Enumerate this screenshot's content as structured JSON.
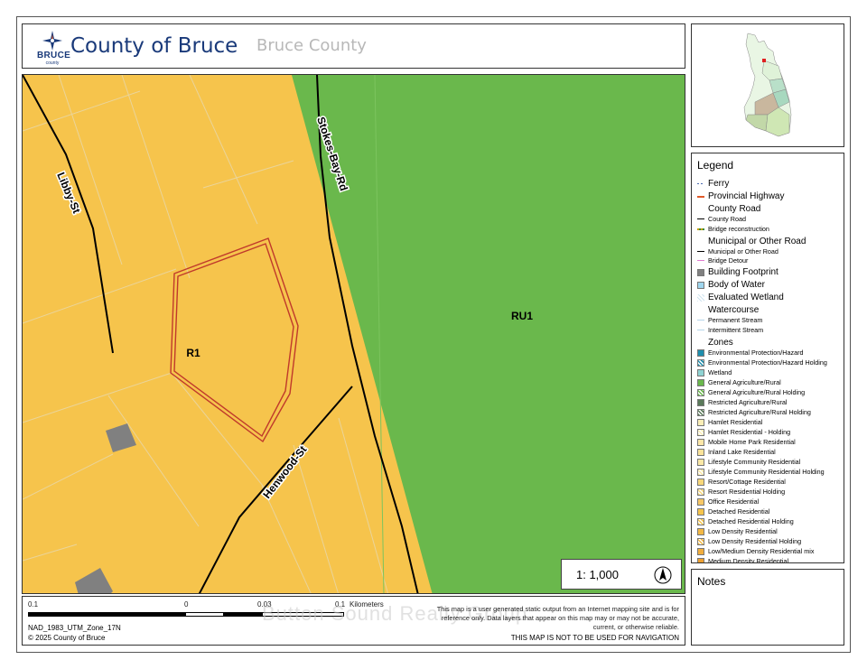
{
  "header": {
    "brand": "BRUCE",
    "brand_sub": "county",
    "title": "County of Bruce",
    "subtitle": "Bruce County"
  },
  "map": {
    "labels": {
      "zone_r1": "R1",
      "zone_ru1": "RU1",
      "road_stokes": "Stokes-Bay-Rd",
      "road_libby": "Libby-St",
      "road_henwood": "Henwood-St"
    },
    "scale_text": "1: 1,000",
    "colors": {
      "residential": "#f6c44c",
      "agriculture": "#6ab84c",
      "building": "#808080",
      "parcel_outline": "#c0392b",
      "lot_lines": "#ead49a"
    }
  },
  "footer": {
    "ticks": [
      "0.1",
      "0",
      "0.03",
      "0.1",
      "Kilometers"
    ],
    "projection": "NAD_1983_UTM_Zone_17N",
    "copyright": "© 2025 County of Bruce",
    "disclaimer": "This map is a user generated static output from an Internet mapping site and is for reference only. Data layers that appear on this map may or may not be accurate, current, or otherwise reliable.",
    "nav_warning": "THIS MAP IS NOT TO BE USED FOR NAVIGATION",
    "watermark": "Button Sound Realty Group"
  },
  "legend": {
    "title": "Legend",
    "items": [
      {
        "label": "Ferry",
        "icon": "ferry-line",
        "size": "md"
      },
      {
        "label": "Provincial Highway",
        "icon": "highway-line",
        "size": "md",
        "color": "#e05a2a"
      },
      {
        "label": "County Road",
        "icon": "none",
        "size": "md"
      },
      {
        "label": "County Road",
        "icon": "black-line",
        "size": "sm"
      },
      {
        "label": "Bridge reconstruction",
        "icon": "bridge-line",
        "size": "sm"
      },
      {
        "label": "Municipal or Other Road",
        "icon": "none",
        "size": "md"
      },
      {
        "label": "Municipal or Other Road",
        "icon": "black-line",
        "size": "sm"
      },
      {
        "label": "Bridge Detour",
        "icon": "pink-line",
        "size": "sm"
      },
      {
        "label": "Building Footprint",
        "icon": "fill",
        "size": "md",
        "color": "#808080"
      },
      {
        "label": "Body of Water",
        "icon": "fill",
        "size": "md",
        "color": "#9fd6ee"
      },
      {
        "label": "Evaluated Wetland",
        "icon": "hatch-light",
        "size": "md",
        "color": "#ffffff"
      },
      {
        "label": "Watercourse",
        "icon": "none",
        "size": "md"
      },
      {
        "label": "Permanent Stream",
        "icon": "thin-line",
        "size": "sm"
      },
      {
        "label": "Intermittent Stream",
        "icon": "thin-line",
        "size": "sm"
      },
      {
        "label": "Zones",
        "icon": "none",
        "size": "md"
      },
      {
        "label": "Environmental Protection/Hazard",
        "icon": "fill",
        "size": "sm",
        "color": "#1f8fae"
      },
      {
        "label": "Environmental Protection/Hazard Holding",
        "icon": "hatch",
        "size": "sm",
        "color": "#1f8fae"
      },
      {
        "label": "Wetland",
        "icon": "fill",
        "size": "sm",
        "color": "#8fd3d3"
      },
      {
        "label": "General Agriculture/Rural",
        "icon": "fill",
        "size": "sm",
        "color": "#6ab84c"
      },
      {
        "label": "General Agriculture/Rural Holding",
        "icon": "hatch",
        "size": "sm",
        "color": "#6ab84c"
      },
      {
        "label": "Restricted Agriculture/Rural",
        "icon": "fill",
        "size": "sm",
        "color": "#5a7a5a"
      },
      {
        "label": "Restricted Agriculture/Rural Holding",
        "icon": "hatch",
        "size": "sm",
        "color": "#5a7a5a"
      },
      {
        "label": "Hamlet Residential",
        "icon": "fill",
        "size": "sm",
        "color": "#fbeeb6"
      },
      {
        "label": "Hamlet Residential - Holding",
        "icon": "hatch",
        "size": "sm",
        "color": "#fbeeb6"
      },
      {
        "label": "Mobile Home Park Residential",
        "icon": "fill",
        "size": "sm",
        "color": "#fde7a8"
      },
      {
        "label": "Inland Lake Residential",
        "icon": "fill",
        "size": "sm",
        "color": "#fbe39a"
      },
      {
        "label": "Lifestyle Community Residential",
        "icon": "fill",
        "size": "sm",
        "color": "#fbe8a6"
      },
      {
        "label": "Lifestyle Community Residential Holding",
        "icon": "hatch",
        "size": "sm",
        "color": "#fbe8a6"
      },
      {
        "label": "Resort/Cottage Residential",
        "icon": "fill",
        "size": "sm",
        "color": "#f8d77a"
      },
      {
        "label": "Resort Residential Holding",
        "icon": "hatch",
        "size": "sm",
        "color": "#f8d77a"
      },
      {
        "label": "Office Residential",
        "icon": "fill",
        "size": "sm",
        "color": "#f7c766"
      },
      {
        "label": "Detached Residential",
        "icon": "fill",
        "size": "sm",
        "color": "#f6c44c"
      },
      {
        "label": "Detached Residential Holding",
        "icon": "hatch",
        "size": "sm",
        "color": "#f6c44c"
      },
      {
        "label": "Low Density Residential",
        "icon": "fill",
        "size": "sm",
        "color": "#f3b845"
      },
      {
        "label": "Low Density Residential Holding",
        "icon": "hatch",
        "size": "sm",
        "color": "#f3b845"
      },
      {
        "label": "Low/Medium Density Residential mix",
        "icon": "fill",
        "size": "sm",
        "color": "#f1ad3d"
      },
      {
        "label": "Medium Density Residential",
        "icon": "fill",
        "size": "sm",
        "color": "#eea030"
      }
    ]
  },
  "notes": {
    "title": "Notes"
  }
}
